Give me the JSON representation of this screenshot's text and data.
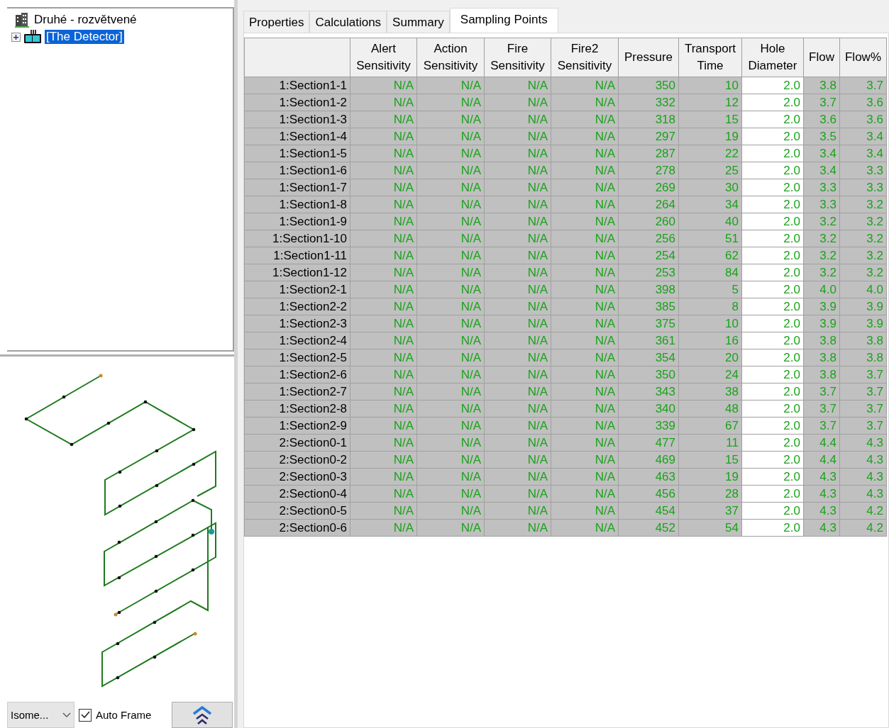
{
  "tree": [
    {
      "label": "Druhé - rozvětvené",
      "kind": "building",
      "selected": false,
      "children": [
        {
          "label": "[The Detector]",
          "kind": "detector",
          "selected": true,
          "expanded": false
        }
      ]
    }
  ],
  "view_controls": {
    "view_select": {
      "value": "Isome..."
    },
    "auto_frame": {
      "label": "Auto Frame",
      "checked": true
    }
  },
  "tabs": [
    {
      "label": "Properties",
      "selected": false
    },
    {
      "label": "Calculations",
      "selected": false
    },
    {
      "label": "Summary",
      "selected": false
    },
    {
      "label": "Sampling Points",
      "selected": true
    }
  ],
  "table": {
    "columns": [
      {
        "editable": false
      },
      {
        "label": "Alert Sensitivity",
        "editable": false
      },
      {
        "label": "Action Sensitivity",
        "editable": false
      },
      {
        "label": "Fire Sensitivity",
        "editable": false
      },
      {
        "label": "Fire2 Sensitivity",
        "editable": false
      },
      {
        "label": "Pressure",
        "editable": false
      },
      {
        "label": "Transport Time",
        "editable": false
      },
      {
        "label": "Hole Diameter",
        "editable": true
      },
      {
        "label": "Flow",
        "editable": false
      },
      {
        "label": "Flow%",
        "editable": false
      }
    ],
    "rows": [
      [
        "1:Section1-1",
        "N/A",
        "N/A",
        "N/A",
        "N/A",
        "350",
        "10",
        "2.0",
        "3.8",
        "3.7"
      ],
      [
        "1:Section1-2",
        "N/A",
        "N/A",
        "N/A",
        "N/A",
        "332",
        "12",
        "2.0",
        "3.7",
        "3.6"
      ],
      [
        "1:Section1-3",
        "N/A",
        "N/A",
        "N/A",
        "N/A",
        "318",
        "15",
        "2.0",
        "3.6",
        "3.6"
      ],
      [
        "1:Section1-4",
        "N/A",
        "N/A",
        "N/A",
        "N/A",
        "297",
        "19",
        "2.0",
        "3.5",
        "3.4"
      ],
      [
        "1:Section1-5",
        "N/A",
        "N/A",
        "N/A",
        "N/A",
        "287",
        "22",
        "2.0",
        "3.4",
        "3.4"
      ],
      [
        "1:Section1-6",
        "N/A",
        "N/A",
        "N/A",
        "N/A",
        "278",
        "25",
        "2.0",
        "3.4",
        "3.3"
      ],
      [
        "1:Section1-7",
        "N/A",
        "N/A",
        "N/A",
        "N/A",
        "269",
        "30",
        "2.0",
        "3.3",
        "3.3"
      ],
      [
        "1:Section1-8",
        "N/A",
        "N/A",
        "N/A",
        "N/A",
        "264",
        "34",
        "2.0",
        "3.3",
        "3.2"
      ],
      [
        "1:Section1-9",
        "N/A",
        "N/A",
        "N/A",
        "N/A",
        "260",
        "40",
        "2.0",
        "3.2",
        "3.2"
      ],
      [
        "1:Section1-10",
        "N/A",
        "N/A",
        "N/A",
        "N/A",
        "256",
        "51",
        "2.0",
        "3.2",
        "3.2"
      ],
      [
        "1:Section1-11",
        "N/A",
        "N/A",
        "N/A",
        "N/A",
        "254",
        "62",
        "2.0",
        "3.2",
        "3.2"
      ],
      [
        "1:Section1-12",
        "N/A",
        "N/A",
        "N/A",
        "N/A",
        "253",
        "84",
        "2.0",
        "3.2",
        "3.2"
      ],
      [
        "1:Section2-1",
        "N/A",
        "N/A",
        "N/A",
        "N/A",
        "398",
        "5",
        "2.0",
        "4.0",
        "4.0"
      ],
      [
        "1:Section2-2",
        "N/A",
        "N/A",
        "N/A",
        "N/A",
        "385",
        "8",
        "2.0",
        "3.9",
        "3.9"
      ],
      [
        "1:Section2-3",
        "N/A",
        "N/A",
        "N/A",
        "N/A",
        "375",
        "10",
        "2.0",
        "3.9",
        "3.9"
      ],
      [
        "1:Section2-4",
        "N/A",
        "N/A",
        "N/A",
        "N/A",
        "361",
        "16",
        "2.0",
        "3.8",
        "3.8"
      ],
      [
        "1:Section2-5",
        "N/A",
        "N/A",
        "N/A",
        "N/A",
        "354",
        "20",
        "2.0",
        "3.8",
        "3.8"
      ],
      [
        "1:Section2-6",
        "N/A",
        "N/A",
        "N/A",
        "N/A",
        "350",
        "24",
        "2.0",
        "3.8",
        "3.7"
      ],
      [
        "1:Section2-7",
        "N/A",
        "N/A",
        "N/A",
        "N/A",
        "343",
        "38",
        "2.0",
        "3.7",
        "3.7"
      ],
      [
        "1:Section2-8",
        "N/A",
        "N/A",
        "N/A",
        "N/A",
        "340",
        "48",
        "2.0",
        "3.7",
        "3.7"
      ],
      [
        "1:Section2-9",
        "N/A",
        "N/A",
        "N/A",
        "N/A",
        "339",
        "67",
        "2.0",
        "3.7",
        "3.7"
      ],
      [
        "2:Section0-1",
        "N/A",
        "N/A",
        "N/A",
        "N/A",
        "477",
        "11",
        "2.0",
        "4.4",
        "4.3"
      ],
      [
        "2:Section0-2",
        "N/A",
        "N/A",
        "N/A",
        "N/A",
        "469",
        "15",
        "2.0",
        "4.4",
        "4.3"
      ],
      [
        "2:Section0-3",
        "N/A",
        "N/A",
        "N/A",
        "N/A",
        "463",
        "19",
        "2.0",
        "4.3",
        "4.3"
      ],
      [
        "2:Section0-4",
        "N/A",
        "N/A",
        "N/A",
        "N/A",
        "456",
        "28",
        "2.0",
        "4.3",
        "4.3"
      ],
      [
        "2:Section0-5",
        "N/A",
        "N/A",
        "N/A",
        "N/A",
        "454",
        "37",
        "2.0",
        "4.3",
        "4.2"
      ],
      [
        "2:Section0-6",
        "N/A",
        "N/A",
        "N/A",
        "N/A",
        "452",
        "54",
        "2.0",
        "4.3",
        "4.2"
      ]
    ]
  }
}
